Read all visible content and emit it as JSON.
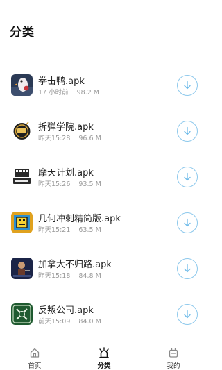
{
  "header": {
    "title": "分类"
  },
  "items": [
    {
      "name": "拳击鸭.apk",
      "time": "17 小时前",
      "size": "98.2 M",
      "icon": "duck-boxer-app-icon"
    },
    {
      "name": "拆弹学院.apk",
      "time": "昨天15:28",
      "size": "96.6 M",
      "icon": "bomb-academy-app-icon"
    },
    {
      "name": "摩天计划.apk",
      "time": "昨天15:26",
      "size": "93.5 M",
      "icon": "highrise-app-icon"
    },
    {
      "name": "几何冲刺精简版.apk",
      "time": "昨天15:21",
      "size": "63.5 M",
      "icon": "geometry-dash-app-icon"
    },
    {
      "name": "加拿大不归路.apk",
      "time": "昨天15:18",
      "size": "84.8 M",
      "icon": "death-road-canada-app-icon"
    },
    {
      "name": "反叛公司.apk",
      "time": "前天15:09",
      "size": "84.0 M",
      "icon": "rebel-inc-app-icon"
    }
  ],
  "tabbar": {
    "home_label": "首页",
    "category_label": "分类",
    "mine_label": "我的",
    "active": "category"
  },
  "colors": {
    "accent": "#5fb3e6",
    "muted": "#9a9a9a"
  }
}
